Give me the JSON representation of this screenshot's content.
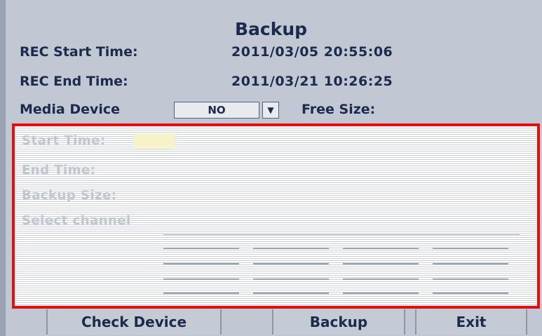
{
  "title": "Backup",
  "rec_start": {
    "label": "REC Start Time:",
    "value": "2011/03/05 20:55:06"
  },
  "rec_end": {
    "label": "REC End Time:",
    "value": "2011/03/21 10:26:25"
  },
  "media": {
    "label": "Media Device",
    "selected": "NO",
    "free_size_label": "Free Size:"
  },
  "panel": {
    "start_label": "Start Time:",
    "end_label": "End Time:",
    "size_label": "Backup Size:",
    "channel_label": "Select channel"
  },
  "buttons": {
    "check": "Check Device",
    "backup": "Backup",
    "exit": "Exit"
  }
}
